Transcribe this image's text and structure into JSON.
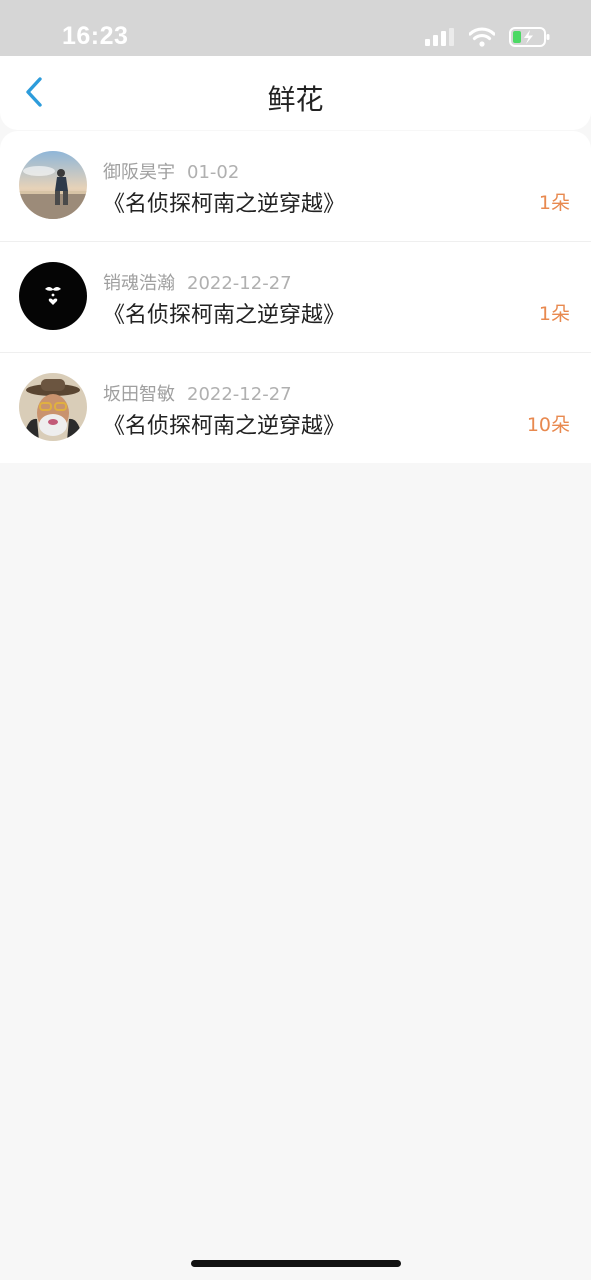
{
  "status_bar": {
    "time": "16:23",
    "icons": [
      "signal-icon",
      "wifi-icon",
      "battery-charging-icon"
    ]
  },
  "nav": {
    "back_icon": "chevron-left-icon",
    "title": "鲜花",
    "accent_color": "#2d9cdb"
  },
  "gifts": [
    {
      "user": "御阪昊宇",
      "date": "01-02",
      "book": "《名侦探柯南之逆穿越》",
      "count": "1朵"
    },
    {
      "user": "销魂浩瀚",
      "date": "2022-12-27",
      "book": "《名侦探柯南之逆穿越》",
      "count": "1朵"
    },
    {
      "user": "坂田智敏",
      "date": "2022-12-27",
      "book": "《名侦探柯南之逆穿越》",
      "count": "10朵"
    }
  ],
  "colors": {
    "count": "#e8894f",
    "background": "#f7f7f7",
    "status_bar": "#d6d6d6"
  }
}
